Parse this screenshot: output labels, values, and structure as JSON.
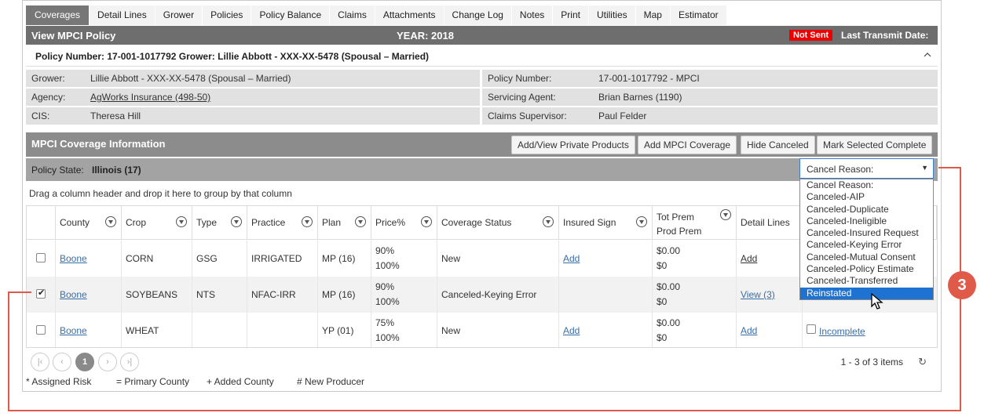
{
  "tabs": [
    "Coverages",
    "Detail Lines",
    "Grower",
    "Policies",
    "Policy Balance",
    "Claims",
    "Attachments",
    "Change Log",
    "Notes",
    "Print",
    "Utilities",
    "Map",
    "Estimator"
  ],
  "active_tab": "Coverages",
  "titlebar": {
    "title": "View MPCI Policy",
    "year": "YEAR: 2018",
    "status_badge": "Not Sent",
    "last_transmit": "Last Transmit Date:"
  },
  "policy_line": {
    "text": "Policy Number: 17-001-1017792 Grower: Lillie Abbott - XXX-XX-5478 (Spousal – Married)",
    "collapse_icon": "chevron-up-icon"
  },
  "info": {
    "grower_label": "Grower:",
    "grower_value": "Lillie Abbott - XXX-XX-5478 (Spousal – Married)",
    "policy_number_label": "Policy Number:",
    "policy_number_value": "17-001-1017792 - MPCI",
    "agency_label": "Agency:",
    "agency_value": "AgWorks Insurance (498-50)",
    "servicing_agent_label": "Servicing Agent:",
    "servicing_agent_value": "Brian Barnes (1190)",
    "cis_label": "CIS:",
    "cis_value": "Theresa Hill",
    "claims_supervisor_label": "Claims Supervisor:",
    "claims_supervisor_value": "Paul Felder"
  },
  "coverage": {
    "title": "MPCI Coverage Information",
    "buttons": {
      "private_products": "Add/View Private Products",
      "add_coverage": "Add MPCI Coverage",
      "hide_canceled": "Hide Canceled",
      "mark_complete": "Mark Selected Complete"
    },
    "policy_state_label": "Policy State:",
    "policy_state_value": "Illinois (17)",
    "drag_note": "Drag a column header and drop it here to group by that column"
  },
  "cancel_dropdown": {
    "selected": "Cancel Reason:",
    "options": [
      "Cancel Reason:",
      "Canceled-AIP",
      "Canceled-Duplicate",
      "Canceled-Ineligible",
      "Canceled-Insured Request",
      "Canceled-Keying Error",
      "Canceled-Mutual Consent",
      "Canceled-Policy Estimate",
      "Canceled-Transferred",
      "Reinstated"
    ],
    "highlighted": "Reinstated"
  },
  "grid": {
    "headers": {
      "county": "County",
      "crop": "Crop",
      "type": "Type",
      "practice": "Practice",
      "plan": "Plan",
      "price": "Price%",
      "coverage_status": "Coverage Status",
      "insured_sign": "Insured Sign",
      "tot_prem": "Tot Prem",
      "prod_prem": "Prod Prem",
      "detail_lines": "Detail Lines"
    },
    "rows": [
      {
        "checked": false,
        "county": "Boone",
        "crop": "CORN",
        "type": "GSG",
        "practice": "IRRIGATED",
        "plan": "MP (16)",
        "price1": "90%",
        "price2": "100%",
        "status": "New",
        "insured_sign": "Add",
        "tot_prem": "$0.00",
        "prod_prem": "$0",
        "detail": "Add",
        "extra": ""
      },
      {
        "checked": true,
        "county": "Boone",
        "crop": "SOYBEANS",
        "type": "NTS",
        "practice": "NFAC-IRR",
        "plan": "MP (16)",
        "price1": "90%",
        "price2": "100%",
        "status": "Canceled-Keying Error",
        "insured_sign": "",
        "tot_prem": "$0.00",
        "prod_prem": "$0",
        "detail": "View (3)",
        "extra": ""
      },
      {
        "checked": false,
        "county": "Boone",
        "crop": "WHEAT",
        "type": "",
        "practice": "",
        "plan": "YP (01)",
        "price1": "75%",
        "price2": "100%",
        "status": "New",
        "insured_sign": "Add",
        "tot_prem": "$0.00",
        "prod_prem": "$0",
        "detail": "Add",
        "extra": "Incomplete"
      }
    ]
  },
  "pager": {
    "current_page": "1",
    "info": "1 - 3 of 3 items"
  },
  "legend": [
    "* Assigned Risk",
    "= Primary County",
    "+ Added County",
    "# New Producer"
  ],
  "callout": {
    "number": "3",
    "color": "#e05a4a"
  }
}
